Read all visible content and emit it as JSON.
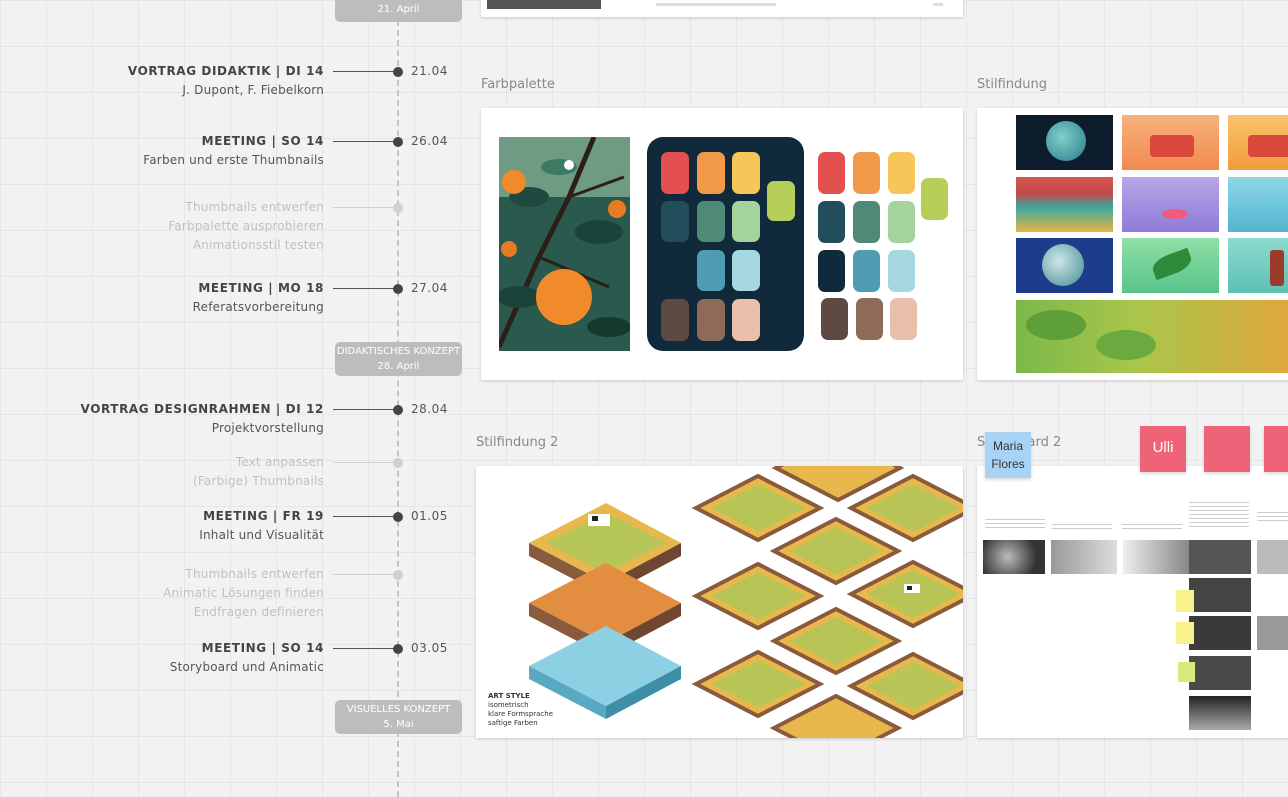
{
  "milestones": [
    {
      "label": "21. April"
    },
    {
      "label": "DIDAKTISCHES KONZEPT",
      "date": "28. April"
    },
    {
      "label": "VISUELLES KONZEPT",
      "date": "5. Mai"
    }
  ],
  "events": [
    {
      "title": "VORTRAG DIDAKTIK | DI 14",
      "subtitle": "J. Dupont, F. Fiebelkorn",
      "date": "21.04"
    },
    {
      "title": "MEETING | SO 14",
      "subtitle": "Farben und erste Thumbnails",
      "date": "26.04"
    },
    {
      "title": "MEETING | MO 18",
      "subtitle": "Referatsvorbereitung",
      "date": "27.04"
    },
    {
      "title": "VORTRAG DESIGNRAHMEN | DI 12",
      "subtitle": "Projektvorstellung",
      "date": "28.04"
    },
    {
      "title": "MEETING | FR 19",
      "subtitle": "Inhalt und Visualität",
      "date": "01.05"
    },
    {
      "title": "MEETING | SO 14",
      "subtitle": "Storyboard und Animatic",
      "date": "03.05"
    }
  ],
  "tasks": [
    [
      "Thumbnails entwerfen",
      "Farbpalette ausprobieren",
      "Animationsstil testen"
    ],
    [
      "Text anpassen",
      "(Farbige) Thumbnails"
    ],
    [
      "Thumbnails entwerfen",
      "Animatic Lösungen finden",
      "Endfragen definieren"
    ]
  ],
  "frames": {
    "farbpalette": "Farbpalette",
    "stilfindung": "Stilfindung",
    "stilfindung2": "Stilfindung 2",
    "storyboard2": "Storyboard 2"
  },
  "art_style": {
    "heading": "ART STYLE",
    "lines": [
      "isometrisch",
      "klare Formsprache",
      "saftige Farben"
    ]
  },
  "stickies": [
    {
      "name": "Maria Flores",
      "color": "#a9d3f5"
    },
    {
      "name": "Ulli",
      "color": "#ee6378"
    }
  ],
  "colors": {
    "canvas": "#f2f2f2",
    "palette_panel": "#102a3c",
    "timeline_dark": "#444444",
    "timeline_faint": "#cfcfcf",
    "badge": "#bdbdbd"
  }
}
